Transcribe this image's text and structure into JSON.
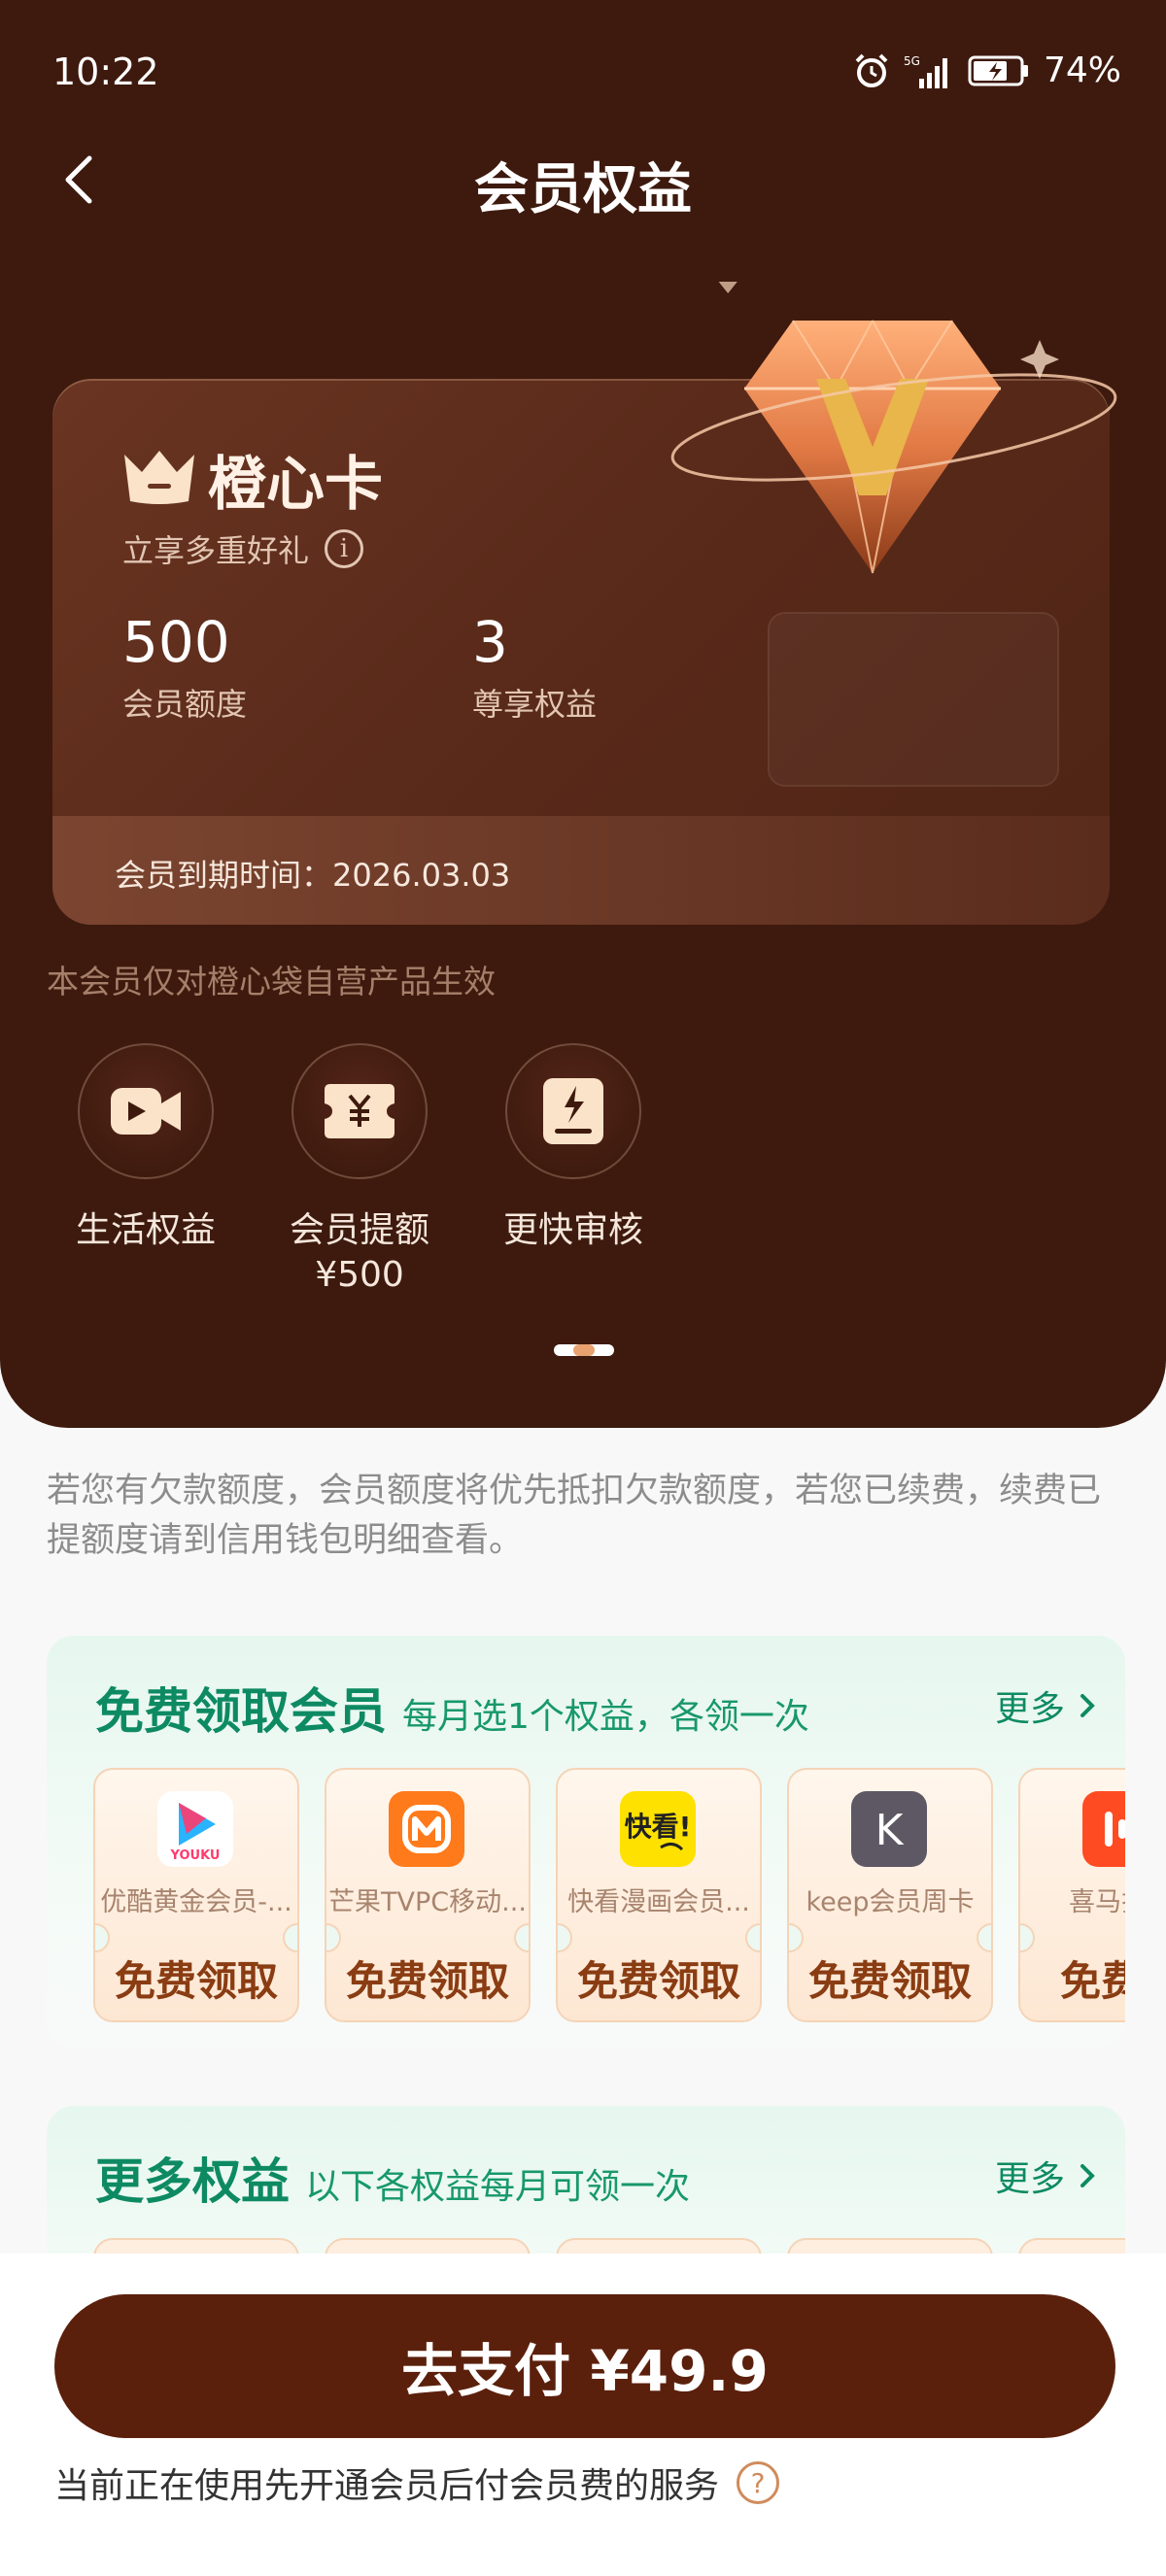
{
  "status_bar": {
    "time": "10:22",
    "battery": "74%",
    "network": "5G",
    "battery_level": 0.74
  },
  "nav": {
    "title": "会员权益",
    "back_icon": "chevron-left-icon"
  },
  "card": {
    "name": "橙心卡",
    "subtitle": "立享多重好礼",
    "info_icon_glyph": "i",
    "stats": [
      {
        "value": "500",
        "label": "会员额度"
      },
      {
        "value": "3",
        "label": "尊享权益"
      }
    ],
    "expiry": "会员到期时间：2026.03.03"
  },
  "hero_note": "本会员仅对橙心袋自营产品生效",
  "benefits": [
    {
      "label": "生活权益",
      "icon": "video-camera-icon"
    },
    {
      "label": "会员提额\n¥500",
      "icon": "yuan-ticket-icon"
    },
    {
      "label": "更快审核",
      "icon": "fast-review-icon"
    }
  ],
  "notice": "若您有欠款额度，会员额度将优先抵扣欠款额度，若您已续费，续费已提额度请到信用钱包明细查看。",
  "free_panel": {
    "title": "免费领取会员",
    "desc": "每月选1个权益，各领一次",
    "more": "更多",
    "items": [
      {
        "name": "优酷黄金会员-...",
        "action": "免费领取",
        "logo_text": "YOUKU"
      },
      {
        "name": "芒果TVPC移动...",
        "action": "免费领取",
        "logo_text": ""
      },
      {
        "name": "快看漫画会员...",
        "action": "免费领取",
        "logo_text": "快看!"
      },
      {
        "name": "keep会员周卡",
        "action": "免费领取",
        "logo_text": "K"
      },
      {
        "name": "喜马拉雅",
        "action": "免费领",
        "logo_text": ""
      }
    ]
  },
  "more_panel": {
    "title": "更多权益",
    "desc": "以下各权益每月可领一次",
    "more": "更多"
  },
  "paybar": {
    "button": "去支付 ¥49.9",
    "note": "当前正在使用先开通会员后付会员费的服务",
    "help_glyph": "?"
  },
  "colors": {
    "hero_bg": "#3e1a0e",
    "pay_button": "#5b200c",
    "accent_green": "#0e8a63",
    "ticket_text": "#8a3c12"
  }
}
